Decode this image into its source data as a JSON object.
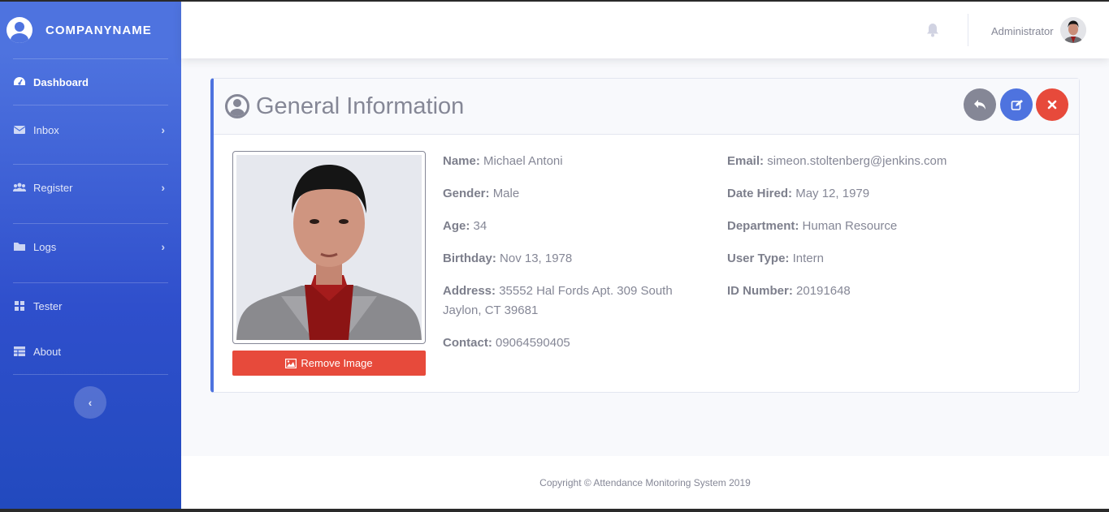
{
  "brand": {
    "name": "COMPANYNAME"
  },
  "sidebar": {
    "items": [
      {
        "label": "Dashboard",
        "icon": "tachometer-icon",
        "active": true,
        "has_children": false
      },
      {
        "label": "Inbox",
        "icon": "envelope-icon",
        "active": false,
        "has_children": true
      },
      {
        "label": "Register",
        "icon": "users-icon",
        "active": false,
        "has_children": true
      },
      {
        "label": "Logs",
        "icon": "folder-icon",
        "active": false,
        "has_children": true
      },
      {
        "label": "Tester",
        "icon": "grid-icon",
        "active": false,
        "has_children": false
      },
      {
        "label": "About",
        "icon": "table-icon",
        "active": false,
        "has_children": false
      }
    ],
    "toggle_icon": "chevron-left-icon"
  },
  "topbar": {
    "user_name": "Administrator",
    "notification_icon": "bell-icon"
  },
  "card": {
    "title": "General Information",
    "buttons": {
      "back": "reply-icon",
      "edit": "edit-icon",
      "delete": "times-icon"
    },
    "remove_image_label": "Remove Image"
  },
  "profile": {
    "left": [
      {
        "label": "Name:",
        "value": "Michael Antoni"
      },
      {
        "label": "Gender:",
        "value": "Male"
      },
      {
        "label": "Age:",
        "value": "34"
      },
      {
        "label": "Birthday:",
        "value": "Nov 13, 1978"
      },
      {
        "label": "Address:",
        "value": "35552 Hal Fords Apt. 309 South Jaylon, CT 39681"
      },
      {
        "label": "Contact:",
        "value": "09064590405"
      }
    ],
    "right": [
      {
        "label": "Email:",
        "value": "simeon.stoltenberg@jenkins.com"
      },
      {
        "label": "Date Hired:",
        "value": "May 12, 1979"
      },
      {
        "label": "Department:",
        "value": "Human Resource"
      },
      {
        "label": "User Type:",
        "value": "Intern"
      },
      {
        "label": "ID Number:",
        "value": "20191648"
      }
    ]
  },
  "footer": {
    "copyright": "Copyright © Attendance Monitoring System 2019"
  },
  "colors": {
    "primary": "#4e73df",
    "danger": "#e74a3b",
    "secondary": "#858796"
  }
}
